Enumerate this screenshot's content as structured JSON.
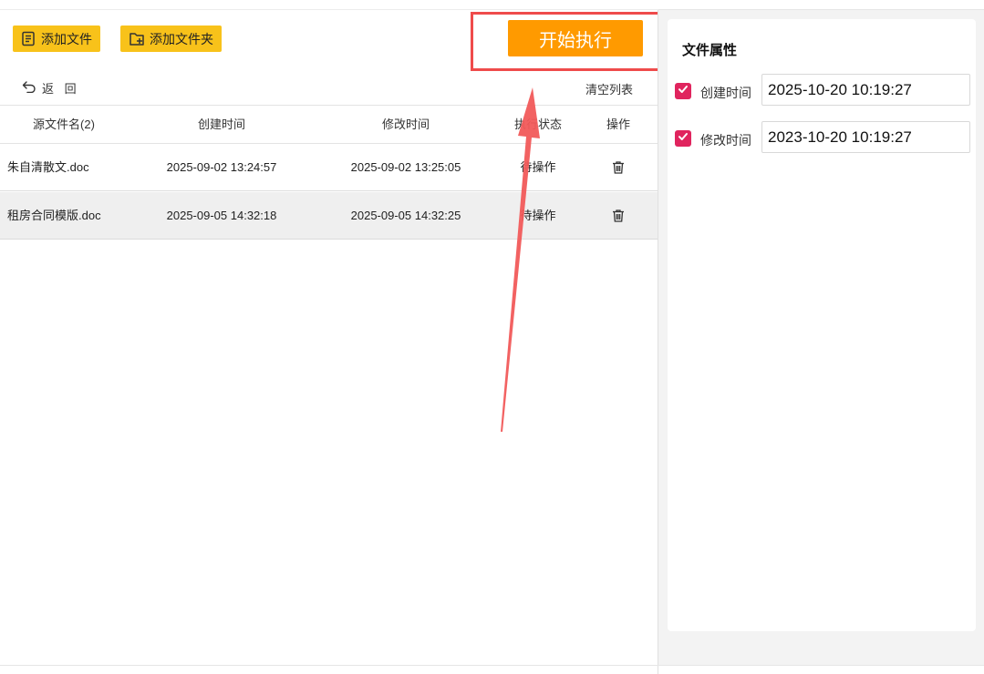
{
  "toolbar": {
    "add_file_label": "添加文件",
    "add_folder_label": "添加文件夹",
    "start_label": "开始执行"
  },
  "nav": {
    "back_label": "返 回",
    "clear_label": "清空列表"
  },
  "table": {
    "headers": [
      "源文件名(2)",
      "创建时间",
      "修改时间",
      "执行状态",
      "操作"
    ],
    "rows": [
      {
        "name": "朱自清散文.doc",
        "created": "2025-09-02 13:24:57",
        "modified": "2025-09-02 13:25:05",
        "status": "待操作"
      },
      {
        "name": "租房合同模版.doc",
        "created": "2025-09-05 14:32:18",
        "modified": "2025-09-05 14:32:25",
        "status": "待操作"
      }
    ]
  },
  "properties": {
    "title": "文件属性",
    "created_label": "创建时间",
    "created_value": "2025-10-20 10:19:27",
    "created_checked": true,
    "modified_label": "修改时间",
    "modified_value": "2023-10-20 10:19:27",
    "modified_checked": true
  },
  "colors": {
    "accent_yellow": "#f8c21a",
    "start_orange": "#ff9a00",
    "checkbox": "#e0245e",
    "annotation_red": "#ef4b4b"
  },
  "icons": {
    "add_file": "file-list-icon",
    "add_folder": "folder-add-icon",
    "back": "undo-arrow-icon",
    "delete": "trash-icon"
  }
}
